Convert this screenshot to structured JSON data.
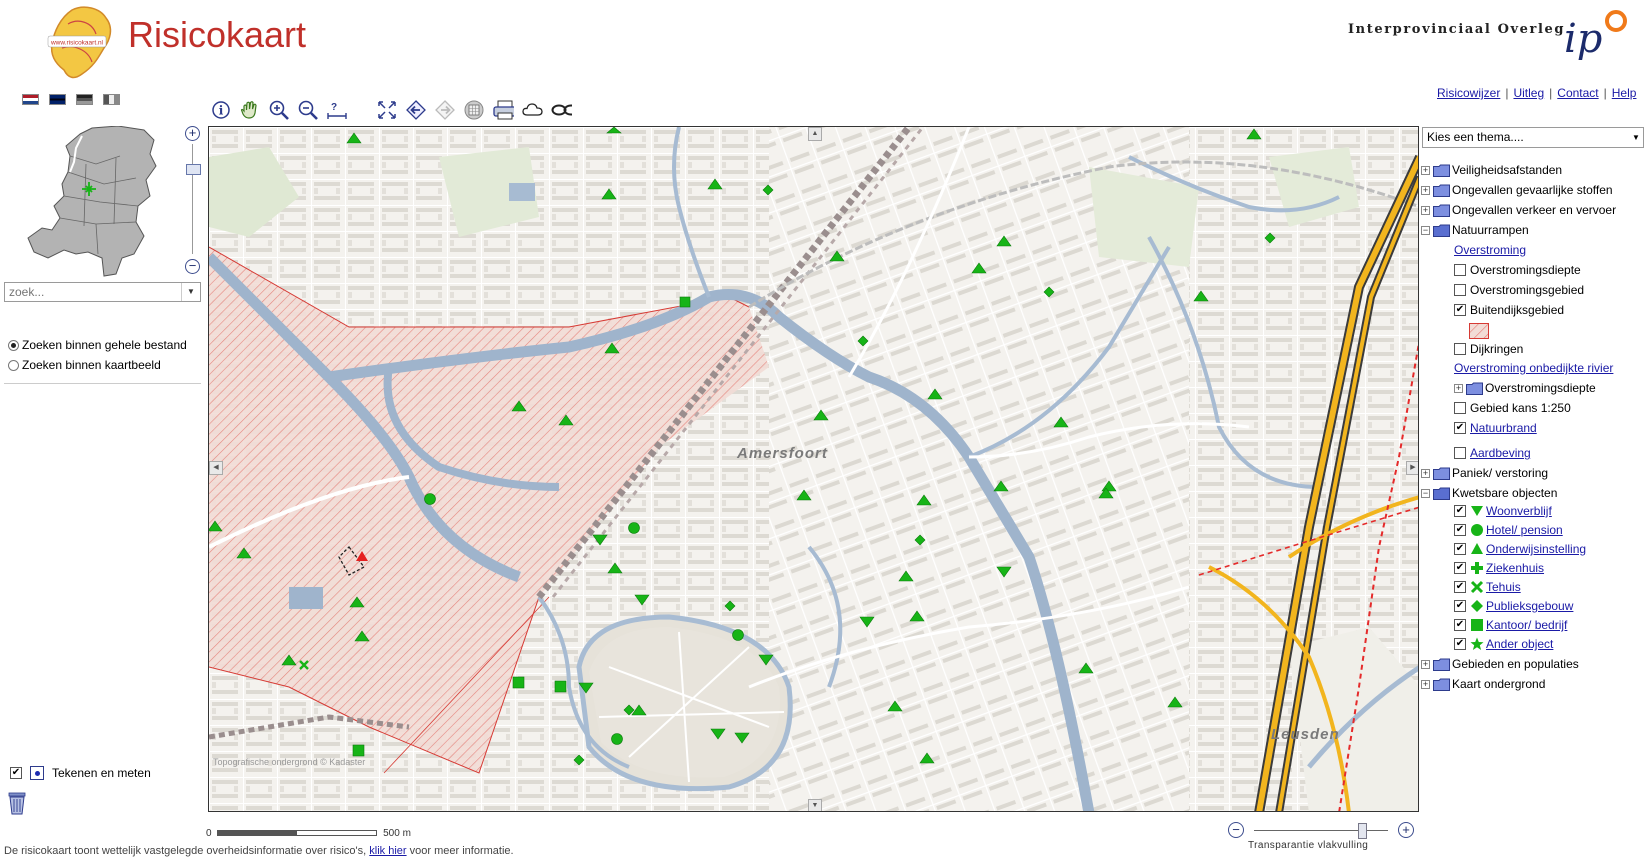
{
  "header": {
    "brand": "Risicokaart",
    "logo_text": "www.risicokaart.nl",
    "org_name": "Interprovinciaal Overleg",
    "org_logo_text": "ip"
  },
  "languages": [
    {
      "name": "nl-flag-icon"
    },
    {
      "name": "uk-flag-icon"
    },
    {
      "name": "de-flag-icon"
    },
    {
      "name": "fr-flag-icon"
    }
  ],
  "toolbar": [
    "info-icon",
    "pan-hand-icon",
    "zoom-in-icon",
    "zoom-out-icon",
    "measure-icon",
    "full-extent-icon",
    "back-icon",
    "forward-icon",
    "buffer-icon",
    "print-icon",
    "cloud-icon",
    "link-icon"
  ],
  "top_links": [
    "Risicowijzer",
    "Uitleg",
    "Contact",
    "Help"
  ],
  "search": {
    "placeholder": "zoek..."
  },
  "search_options": [
    {
      "label": "Zoeken binnen gehele bestand",
      "selected": true
    },
    {
      "label": "Zoeken binnen kaartbeeld",
      "selected": false
    }
  ],
  "draw": {
    "label": "Tekenen en meten",
    "checked": true
  },
  "map": {
    "place_labels": [
      "Amersfoort",
      "Leusden"
    ],
    "watermark": "Topografische ondergrond © Kadaster"
  },
  "scalebar": {
    "start": "0",
    "end": "500 m"
  },
  "footer": {
    "text_before": "De risicokaart toont wettelijk vastgelegde overheidsinformatie over risico's,",
    "link": "klik hier",
    "text_after": "voor meer informatie."
  },
  "transparency": {
    "label": "Transparantie vlakvulling",
    "value": 0.8
  },
  "theme_select": {
    "placeholder": "Kies een thema...."
  },
  "legend": {
    "veiligheid": "Veiligheidsafstanden",
    "ongevallen_stoffen": "Ongevallen gevaarlijke stoffen",
    "ongevallen_verkeer": "Ongevallen verkeer en vervoer",
    "natuurrampen": "Natuurrampen",
    "overstroming": "Overstroming",
    "overstromingsdiepte": "Overstromingsdiepte",
    "overstromingsgebied": "Overstromingsgebied",
    "buitendijksgebied": "Buitendijksgebied",
    "dijkringen": "Dijkringen",
    "overstroming_onbedijkt": "Overstroming onbedijkte rivier",
    "overstromingsdiepte2": "Overstromingsdiepte",
    "gebied_kans": "Gebied kans 1:250",
    "natuurbrand": "Natuurbrand",
    "aardbeving": "Aardbeving",
    "paniek": "Paniek/ verstoring",
    "kwetsbare": "Kwetsbare objecten",
    "woonverblijf": "Woonverblijf",
    "hotel": "Hotel/ pension",
    "onderwijs": "Onderwijsinstelling",
    "ziekenhuis": "Ziekenhuis",
    "tehuis": "Tehuis",
    "publieks": "Publieksgebouw",
    "kantoor": "Kantoor/ bedrijf",
    "ander": "Ander object",
    "gebieden": "Gebieden en populaties",
    "kaart": "Kaart ondergrond"
  },
  "colors": {
    "brand_red": "#c0302a",
    "link_blue": "#1a1aa6",
    "marker_green": "#17b417",
    "flood_hatch": "#e24a4a",
    "water": "#9fb4cc",
    "highway": "#f2b51e"
  }
}
